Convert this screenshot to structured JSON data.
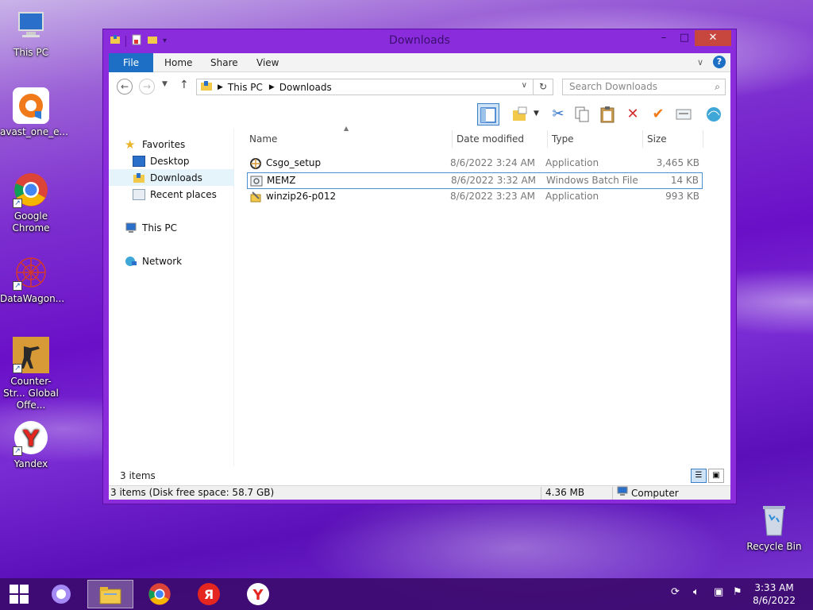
{
  "desktop": {
    "icons": [
      {
        "label": "This PC"
      },
      {
        "label": "avast_one_e..."
      },
      {
        "label": "Google Chrome"
      },
      {
        "label": "DataWagon..."
      },
      {
        "label": "Counter-Str... Global Offe..."
      },
      {
        "label": "Yandex"
      },
      {
        "label": "Recycle Bin"
      }
    ]
  },
  "window": {
    "title": "Downloads",
    "controls": {
      "minimize": "–",
      "maximize": "□",
      "close": "✕"
    },
    "ribbon_tabs": [
      "File",
      "Home",
      "Share",
      "View"
    ],
    "help": "?",
    "address": {
      "crumbs": [
        "This PC",
        "Downloads"
      ]
    },
    "search": {
      "placeholder": "Search Downloads"
    },
    "sidebar": {
      "favorites": "Favorites",
      "desktop": "Desktop",
      "downloads": "Downloads",
      "recent": "Recent places",
      "this_pc": "This PC",
      "network": "Network"
    },
    "columns": {
      "name": "Name",
      "date": "Date modified",
      "type": "Type",
      "size": "Size"
    },
    "files": [
      {
        "name": "Csgo_setup",
        "date": "8/6/2022 3:24 AM",
        "type": "Application",
        "size": "3,465 KB"
      },
      {
        "name": "MEMZ",
        "date": "8/6/2022 3:32 AM",
        "type": "Windows Batch File",
        "size": "14 KB"
      },
      {
        "name": "winzip26-p012",
        "date": "8/6/2022 3:23 AM",
        "type": "Application",
        "size": "993 KB"
      }
    ],
    "item_count": "3 items",
    "status": {
      "left": "3 items (Disk free space: 58.7 GB)",
      "middle": "4.36 MB",
      "right": "Computer"
    }
  },
  "taskbar": {
    "clock_time": "3:33 AM",
    "clock_date": "8/6/2022"
  },
  "colors": {
    "accent": "#1c6fc4",
    "window_frame": "#8a2cdc",
    "close": "#c7463d"
  }
}
